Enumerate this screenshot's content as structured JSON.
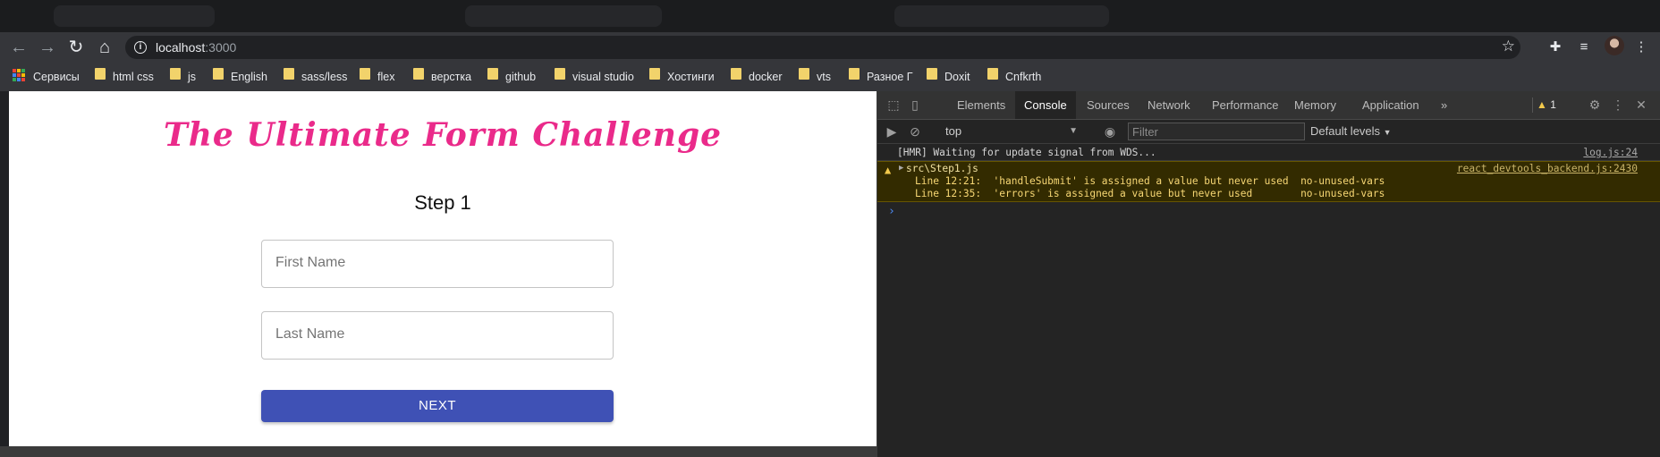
{
  "browser": {
    "url_host": "localhost",
    "url_port": ":3000",
    "bookmarks": [
      {
        "label": "Сервисы",
        "type": "apps"
      },
      {
        "label": "html css",
        "type": "folder"
      },
      {
        "label": "js",
        "type": "folder"
      },
      {
        "label": "English",
        "type": "folder"
      },
      {
        "label": "sass/less",
        "type": "folder"
      },
      {
        "label": "flex",
        "type": "folder"
      },
      {
        "label": "верстка",
        "type": "folder"
      },
      {
        "label": "github",
        "type": "folder"
      },
      {
        "label": "visual studio",
        "type": "folder"
      },
      {
        "label": "Хостинги",
        "type": "folder"
      },
      {
        "label": "docker",
        "type": "folder"
      },
      {
        "label": "vts",
        "type": "folder"
      },
      {
        "label": "Разное Г",
        "type": "folder"
      },
      {
        "label": "Doxit",
        "type": "folder"
      },
      {
        "label": "Cnfkrth",
        "type": "folder"
      }
    ]
  },
  "page": {
    "title": "The Ultimate Form Challenge",
    "step": "Step 1",
    "first_name_placeholder": "First Name",
    "last_name_placeholder": "Last Name",
    "next_label": "NEXT",
    "title_color": "#ea2a8a",
    "button_color": "#3f51b5"
  },
  "devtools": {
    "tabs": [
      "Elements",
      "Console",
      "Sources",
      "Network",
      "Performance",
      "Memory",
      "Application"
    ],
    "active_tab": "Console",
    "more_tabs": "»",
    "warning_count": "1",
    "context": "top",
    "filter_placeholder": "Filter",
    "levels": "Default levels",
    "messages": [
      {
        "text": "[HMR] Waiting for update signal from WDS...",
        "source": "log.js:24"
      }
    ],
    "warning": {
      "file": "src\\Step1.js",
      "source": "react_devtools_backend.js:2430",
      "line1": "Line 12:21:  'handleSubmit' is assigned a value but never used  no-unused-vars",
      "line2": "Line 12:35:  'errors' is assigned a value but never used        no-unused-vars"
    },
    "prompt": "›"
  }
}
